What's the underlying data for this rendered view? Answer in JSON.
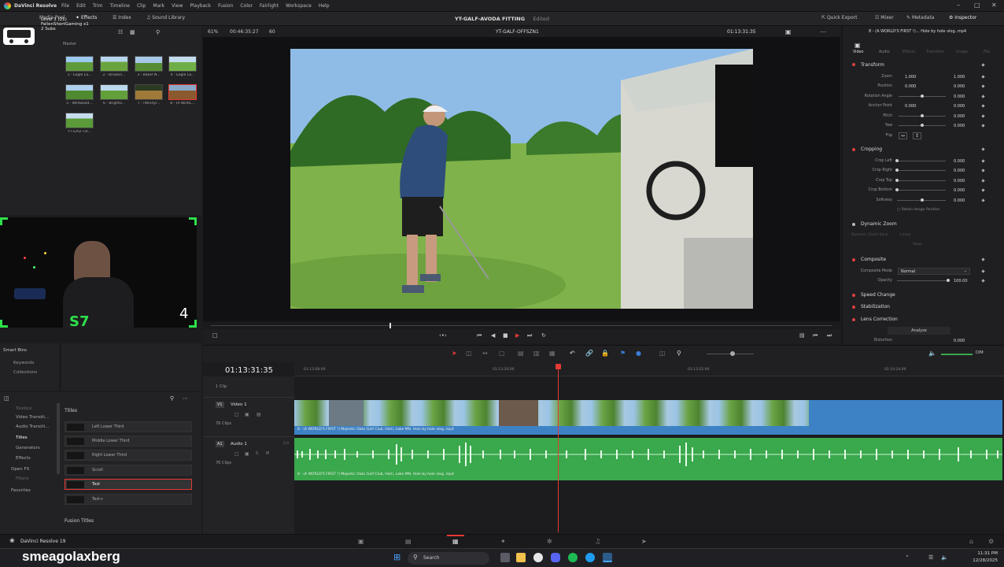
{
  "menubar": {
    "app": "DaVinci Resolve",
    "items": [
      "File",
      "Edit",
      "Trim",
      "Timeline",
      "Clip",
      "Mark",
      "View",
      "Playback",
      "Fusion",
      "Color",
      "Fairlight",
      "Workspace",
      "Help"
    ]
  },
  "toolbar": {
    "media_pool": "Media Pool",
    "effects": "Effects",
    "index": "Index",
    "sound_library": "Sound Library",
    "project_title": "YT-GALF-AVODA FITTING",
    "edited": "Edited",
    "quick_export": "Quick Export",
    "mixer": "Mixer",
    "metadata": "Metadata",
    "inspector": "Inspector"
  },
  "overlay": {
    "level": "Level 1 (21)",
    "user": "FallenShortGaming x1",
    "subs": "2 Subs",
    "master": "Master",
    "username": "smeagolaxberg",
    "counter": "4"
  },
  "viewer": {
    "zoom": "61%",
    "source_tc": "00:46:35:27",
    "fps": "60",
    "timeline_name": "YT-GALF-OFFSZN1",
    "record_tc": "01:13:31:35"
  },
  "media_pool": {
    "clips": [
      {
        "label": "1 - Eagle La..."
      },
      {
        "label": "2 - Brookin..."
      },
      {
        "label": "3 - Baker N..."
      },
      {
        "label": "4 - Eagle La..."
      },
      {
        "label": "5 - Wildwood..."
      },
      {
        "label": "6 - Brighto..."
      },
      {
        "label": "7 - (Windyl..."
      },
      {
        "label": "8 - (A WORL..."
      },
      {
        "label": "YT-GALF-OF..."
      }
    ]
  },
  "smart_bins": {
    "title": "Smart Bins",
    "items": [
      "Keywords",
      "Collections"
    ]
  },
  "effects_library": {
    "nav": [
      "Toolbox",
      "Video Transiti...",
      "Audio Transiti...",
      "Titles",
      "Generators",
      "Effects",
      "Open FX",
      "Filters",
      "Favorites"
    ],
    "titles_header": "Titles",
    "titles": [
      "Left Lower Third",
      "Middle Lower Third",
      "Right Lower Third",
      "Scroll",
      "Text",
      "Text+"
    ],
    "fusion_titles": "Fusion Titles"
  },
  "inspector": {
    "tabs": [
      "Video",
      "Audio",
      "Effects",
      "Transition",
      "Image",
      "File"
    ],
    "clip_name": "8 - (A WORLD'S FIRST !)... Hole by hole vlog..mp4",
    "transform": {
      "header": "Transform",
      "zoom_label": "Zoom",
      "zoom_x": "1.000",
      "zoom_y": "1.000",
      "position_label": "Position",
      "pos_x": "0.000",
      "pos_y": "0.000",
      "rotation_label": "Rotation Angle",
      "rotation": "0.000",
      "anchor_label": "Anchor Point",
      "anchor_x": "0.000",
      "anchor_y": "0.000",
      "pitch_label": "Pitch",
      "pitch": "0.000",
      "yaw_label": "Yaw",
      "yaw": "0.000",
      "flip_label": "Flip"
    },
    "cropping": {
      "header": "Cropping",
      "crop_left_label": "Crop Left",
      "crop_left": "0.000",
      "crop_right_label": "Crop Right",
      "crop_right": "0.000",
      "crop_top_label": "Crop Top",
      "crop_top": "0.000",
      "crop_bottom_label": "Crop Bottom",
      "crop_bottom": "0.000",
      "softness_label": "Softness",
      "softness": "0.000",
      "retain": "Retain Image Position"
    },
    "dynamic_zoom": {
      "header": "Dynamic Zoom",
      "ease_label": "Dynamic Zoom Ease",
      "ease": "Linear",
      "swap": "Swap"
    },
    "composite": {
      "header": "Composite",
      "mode_label": "Composite Mode",
      "mode": "Normal",
      "opacity_label": "Opacity",
      "opacity": "100.00"
    },
    "speed_change": "Speed Change",
    "stabilization": "Stabilization",
    "lens_correction": {
      "header": "Lens Correction",
      "analyze": "Analyze",
      "distortion_label": "Distortion",
      "distortion": "0.000"
    }
  },
  "timeline": {
    "timecode": "01:13:31:35",
    "ruler": [
      "01:13:08:00",
      "01:13:20:00",
      "01:13:52:00",
      "01:14:24:00"
    ],
    "video_track": {
      "id": "V1",
      "name": "Video 1",
      "clips": "76 Clips",
      "clip_label": "8 - (A WORLD'S FIRST !) Majestic Oaks Golf Club, Ham, Lake MN.  Hole by hole vlog..mp4"
    },
    "audio_track": {
      "id": "A1",
      "name": "Audio 1",
      "level": "2.0",
      "clips": "76 Clips",
      "clip_label": "8 - (A WORLD'S FIRST !) Majestic Oaks Golf Club, Ham, Lake MN.  Hole by hole vlog..mp4"
    },
    "one_clip": "1 Clip",
    "dim": "DIM"
  },
  "dvbar": {
    "app": "DaVinci Resolve 19"
  },
  "taskbar": {
    "search": "Search",
    "time": "11:31 PM",
    "date": "12/28/2025"
  },
  "colors": {
    "accent_red": "#e53935",
    "video_clip": "#3d82c4",
    "audio_clip": "#3aa84c"
  }
}
